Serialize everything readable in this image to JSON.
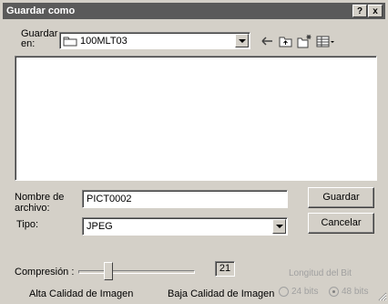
{
  "window": {
    "title": "Guardar como",
    "help_label": "?",
    "close_label": "x"
  },
  "location": {
    "label": "Guardar en:",
    "folder": "100MLT03",
    "icons": [
      "folder-icon",
      "back-arrow-icon",
      "up-folder-icon",
      "new-folder-icon",
      "view-menu-icon"
    ]
  },
  "filename": {
    "label": "Nombre de archivo:",
    "value": "PICT0002"
  },
  "filetype": {
    "label": "Tipo:",
    "value": "JPEG"
  },
  "buttons": {
    "save": "Guardar",
    "cancel": "Cancelar"
  },
  "compression": {
    "label": "Compresión :",
    "value": "21",
    "min_label": "Alta Calidad de Imagen",
    "max_label": "Baja Calidad de Imagen",
    "level_fraction": 0.24
  },
  "bit_length": {
    "label": "Longitud del Bit",
    "options": [
      "24 bits",
      "48 bits"
    ],
    "selected": "48 bits",
    "enabled": false
  },
  "colors": {
    "face": "#d4d0c8",
    "titlebar": "#5a5a5a",
    "disabled_text": "#a0a0a0"
  }
}
